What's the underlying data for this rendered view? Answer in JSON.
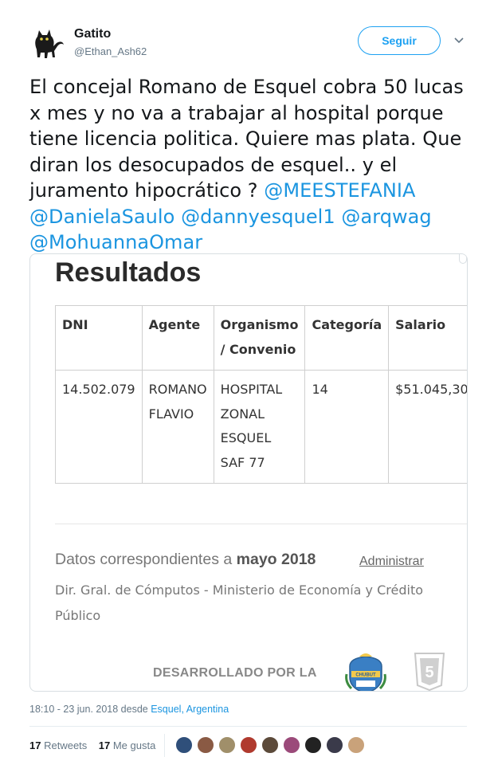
{
  "user": {
    "name": "Gatito",
    "handle": "@Ethan_Ash62",
    "follow_label": "Seguir"
  },
  "tweet": {
    "lines": [
      "El concejal Romano de Esquel cobra 50 lucas",
      "x mes y no va a trabajar al hospital porque",
      "tiene licencia politica. Quiere mas plata. Que",
      "diran los desocupados de esquel.. y el",
      "juramento hipocrático ? "
    ],
    "mentions": [
      "@MEESTEFANIA",
      "@DanielaSaulo",
      "@dannyesquel1",
      "@arqwag",
      "@MohuannaOmar"
    ]
  },
  "card": {
    "title": "Resultados",
    "table": {
      "headers": [
        "DNI",
        "Agente",
        "Organismo / Convenio",
        "Categoría",
        "Salario"
      ],
      "header_lines": {
        "organismo": [
          "Organismo",
          "/ Convenio"
        ]
      },
      "row": {
        "dni": "14.502.079",
        "agente": [
          "ROMANO",
          "FLAVIO"
        ],
        "organismo": [
          "HOSPITAL",
          "ZONAL",
          "ESQUEL",
          "SAF 77"
        ],
        "categoria": "14",
        "salario": "$51.045,30"
      }
    },
    "datos_prefix": "Datos correspondientes a ",
    "datos_period": "mayo 2018",
    "admin_link": "Administrar",
    "direccion": "Dir. Gral. de Cómputos - Ministerio de Economía y Crédito Público",
    "developed_by": "DESARROLLADO POR LA",
    "shield_label": "CHUBUT",
    "html5_label": "5"
  },
  "meta": {
    "time": "18:10 - 23 jun. 2018 desde ",
    "location": "Esquel, Argentina"
  },
  "stats": {
    "retweets_count": "17",
    "retweets_label": "Retweets",
    "likes_count": "17",
    "likes_label": "Me gusta"
  },
  "colors": {
    "accent": "#1da1f2",
    "mention": "#1b95e0",
    "secondary_text": "#657786"
  },
  "likers": [
    {
      "name": "liker-avatar-1",
      "color": "#2f4f7a"
    },
    {
      "name": "liker-avatar-2",
      "color": "#8a5a44"
    },
    {
      "name": "liker-avatar-3",
      "color": "#a08f6a"
    },
    {
      "name": "liker-avatar-4",
      "color": "#b03a2e"
    },
    {
      "name": "liker-avatar-5",
      "color": "#5c4a3a"
    },
    {
      "name": "liker-avatar-6",
      "color": "#9b4a7a"
    },
    {
      "name": "liker-avatar-7",
      "color": "#222222"
    },
    {
      "name": "liker-avatar-8",
      "color": "#3a3a4a"
    },
    {
      "name": "liker-avatar-9",
      "color": "#c9a27a"
    }
  ]
}
